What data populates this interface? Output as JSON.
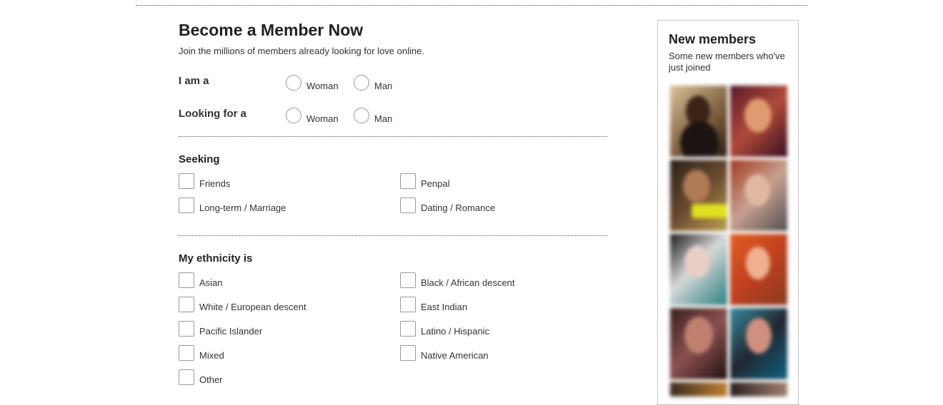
{
  "form": {
    "title": "Become a Member Now",
    "subtitle": "Join the millions of members already looking for love online.",
    "i_am": {
      "label": "I am a",
      "options": [
        "Woman",
        "Man"
      ]
    },
    "looking_for": {
      "label": "Looking for a",
      "options": [
        "Woman",
        "Man"
      ]
    },
    "seeking": {
      "title": "Seeking",
      "options": [
        "Friends",
        "Penpal",
        "Long-term / Marriage",
        "Dating / Romance"
      ]
    },
    "ethnicity": {
      "title": "My ethnicity is",
      "options": [
        "Asian",
        "Black / African descent",
        "White / European descent",
        "East Indian",
        "Pacific Islander",
        "Latino / Hispanic",
        "Mixed",
        "Native American",
        "Other"
      ]
    }
  },
  "sidebar": {
    "title": "New members",
    "subtitle": "Some new members who've just joined"
  }
}
